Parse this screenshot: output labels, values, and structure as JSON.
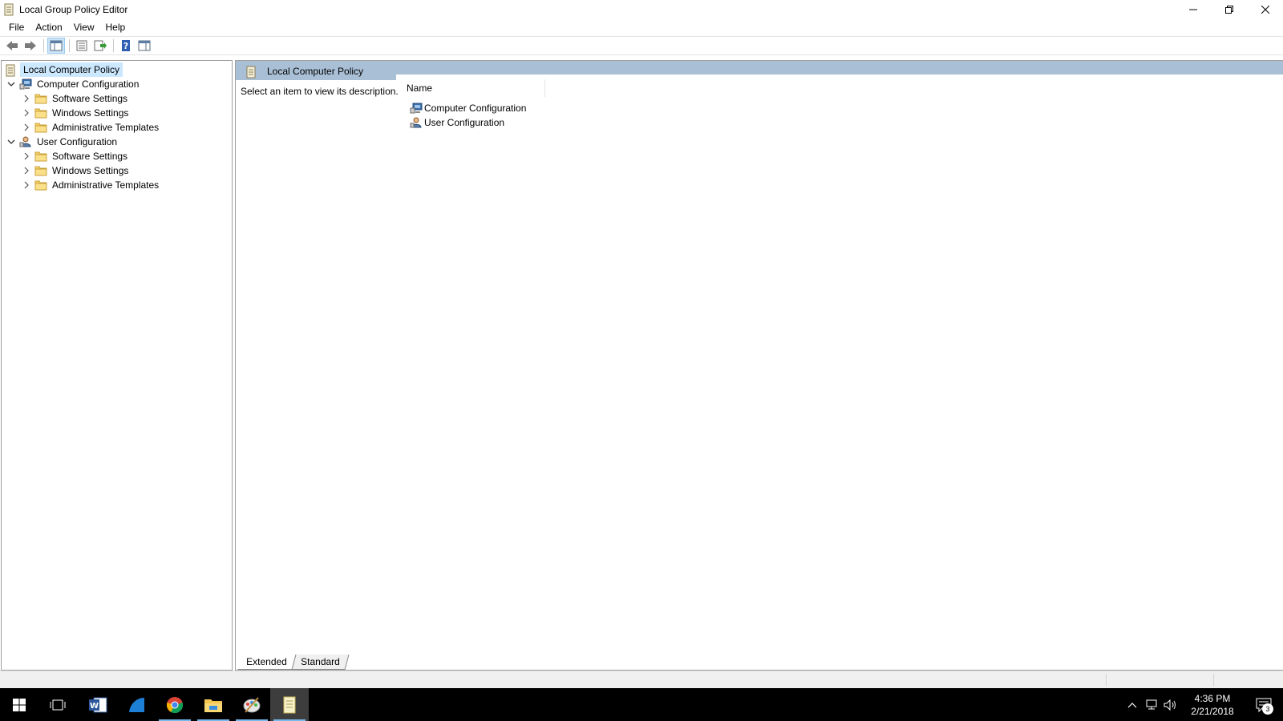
{
  "window": {
    "title": "Local Group Policy Editor",
    "controls": {
      "minimize": "—",
      "restore": "❐",
      "close": "✕"
    }
  },
  "menubar": {
    "items": [
      "File",
      "Action",
      "View",
      "Help"
    ]
  },
  "toolbar": {
    "buttons": [
      "back-arrow-icon",
      "forward-arrow-icon",
      "show-hide-console-tree-icon",
      "properties-icon",
      "export-list-icon",
      "help-icon",
      "show-hide-action-pane-icon"
    ]
  },
  "tree": {
    "root": "Local Computer Policy",
    "computer_config": {
      "label": "Computer Configuration",
      "children": [
        "Software Settings",
        "Windows Settings",
        "Administrative Templates"
      ]
    },
    "user_config": {
      "label": "User Configuration",
      "children": [
        "Software Settings",
        "Windows Settings",
        "Administrative Templates"
      ]
    }
  },
  "content": {
    "header_title": "Local Computer Policy",
    "description": "Select an item to view its description.",
    "column_name": "Name",
    "items": [
      "Computer Configuration",
      "User Configuration"
    ]
  },
  "bottom_tabs": {
    "extended": "Extended",
    "standard": "Standard"
  },
  "taskbar": {
    "apps": [
      "start-icon",
      "task-view-icon",
      "word-icon",
      "edge-icon",
      "chrome-icon",
      "file-explorer-icon",
      "paint-icon",
      "policy-editor-icon"
    ],
    "clock_time": "4:36 PM",
    "clock_date": "2/21/2018",
    "notification_count": "3"
  }
}
